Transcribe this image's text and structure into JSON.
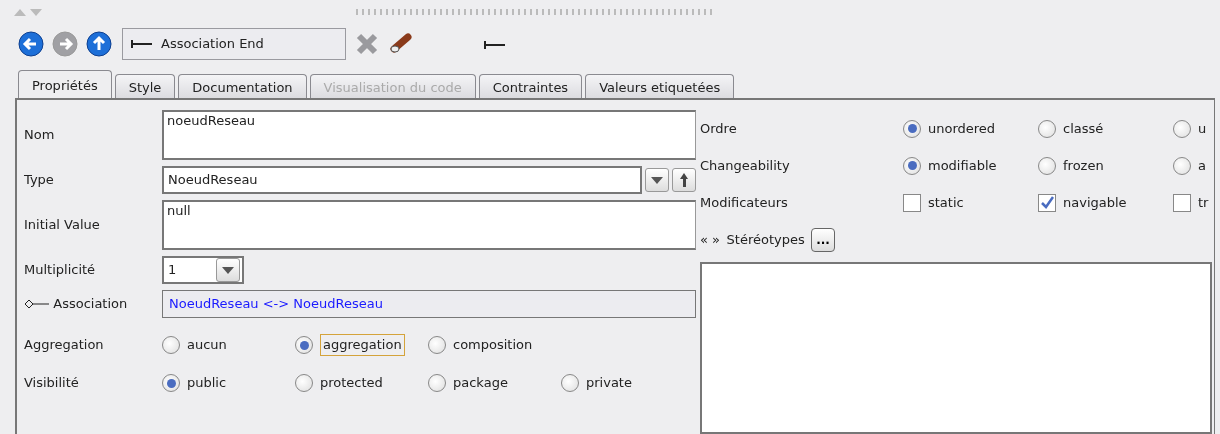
{
  "toolbar": {
    "nav_buttons": [
      {
        "kind": "back",
        "disabled": false
      },
      {
        "kind": "forward",
        "disabled": true
      },
      {
        "kind": "up",
        "disabled": false
      }
    ],
    "title_field": {
      "text": "Association End"
    },
    "actions": [
      {
        "kind": "delete",
        "disabled": true
      },
      {
        "kind": "broom",
        "disabled": false
      }
    ]
  },
  "tabs": [
    {
      "label": "Propriétés",
      "selected": true,
      "disabled": false
    },
    {
      "label": "Style",
      "selected": false,
      "disabled": false
    },
    {
      "label": "Documentation",
      "selected": false,
      "disabled": false
    },
    {
      "label": "Visualisation du code",
      "selected": false,
      "disabled": true
    },
    {
      "label": "Contraintes",
      "selected": false,
      "disabled": false
    },
    {
      "label": "Valeurs etiquetées",
      "selected": false,
      "disabled": false
    }
  ],
  "fields": [
    {
      "kind": "textarea",
      "label": "Nom",
      "value": "noeudReseau"
    },
    {
      "kind": "combo",
      "label": "Type",
      "value": "NoeudReseau"
    },
    {
      "kind": "textarea",
      "label": "Initial Value",
      "value": "null"
    },
    {
      "kind": "small-combo",
      "label": "Multiplicité",
      "value": "1"
    },
    {
      "kind": "link",
      "label": "Association",
      "value": "NoeudReseau <-> NoeudReseau"
    }
  ],
  "left_groups": [
    {
      "label": "Aggregation",
      "options": [
        {
          "kind": "radio",
          "label": "aucun",
          "selected": false,
          "focused": false
        },
        {
          "kind": "radio",
          "label": "aggregation",
          "selected": true,
          "focused": true
        },
        {
          "kind": "radio",
          "label": "composition",
          "selected": false,
          "focused": false
        }
      ]
    },
    {
      "label": "Visibilité",
      "options": [
        {
          "kind": "radio",
          "label": "public",
          "selected": true,
          "focused": false
        },
        {
          "kind": "radio",
          "label": "protected",
          "selected": false,
          "focused": false
        },
        {
          "kind": "radio",
          "label": "package",
          "selected": false,
          "focused": false
        },
        {
          "kind": "radio",
          "label": "private",
          "selected": false,
          "focused": false
        }
      ]
    }
  ],
  "right_groups": [
    {
      "label": "Ordre",
      "options": [
        {
          "kind": "radio",
          "label": "unordered",
          "selected": true
        },
        {
          "kind": "radio",
          "label": "classé",
          "selected": false
        },
        {
          "kind": "radio",
          "label": "u",
          "selected": false
        }
      ]
    },
    {
      "label": "Changeability",
      "options": [
        {
          "kind": "radio",
          "label": "modifiable",
          "selected": true
        },
        {
          "kind": "radio",
          "label": "frozen",
          "selected": false
        },
        {
          "kind": "radio",
          "label": "a",
          "selected": false
        }
      ]
    },
    {
      "label": "Modificateurs",
      "options": [
        {
          "kind": "checkbox",
          "label": "static",
          "checked": false
        },
        {
          "kind": "checkbox",
          "label": "navigable",
          "checked": true
        },
        {
          "kind": "checkbox",
          "label": "tr",
          "checked": false
        }
      ]
    }
  ],
  "stereotypes": {
    "arrows": "« »",
    "label": "Stéréotypes",
    "button": "..."
  }
}
